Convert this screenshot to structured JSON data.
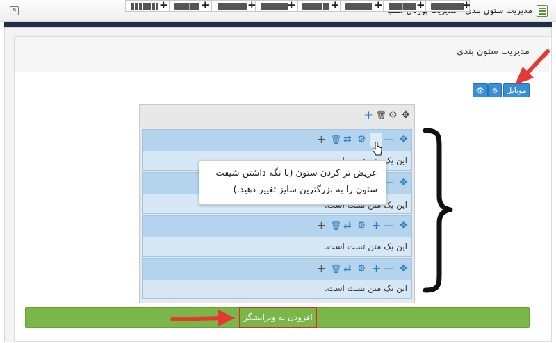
{
  "window": {
    "title": "مدیریت ستون بندی - مدیریت پورتال سمپا",
    "close_glyph": "✕"
  },
  "panel": {
    "title": "مدیریت ستون بندی"
  },
  "toolbar": {
    "mobile_label": "موبایل",
    "eye_icon": "👁",
    "gear_icon": "⚙",
    "layout_buttons_count": 8
  },
  "grid_tools": {
    "move": "✥",
    "settings": "⚙",
    "delete": "🗑",
    "add": "+"
  },
  "rows": [
    {
      "text": "این یک متن تست است."
    },
    {
      "text": "این یک متن تست است."
    },
    {
      "text": "این یک متن تست است."
    },
    {
      "text": "این یک متن تست است."
    }
  ],
  "row_tools": {
    "move": "✥",
    "minus": "—",
    "plus": "+",
    "settings": "⚙",
    "swap": "⇄",
    "delete": "🗑",
    "add": "+"
  },
  "tooltip": {
    "line1": "عریض تر کردن ستون (با نگه داشتن شیفت",
    "line2": "ستون را به بزرگترین سایز تغییر دهید.)"
  },
  "add_to_editor": "افزودن به ویرایشگر",
  "colors": {
    "accent_blue": "#3a8ed6",
    "green": "#7ab648",
    "annotation_red": "#e53935",
    "row_header": "#b3d4ec"
  }
}
